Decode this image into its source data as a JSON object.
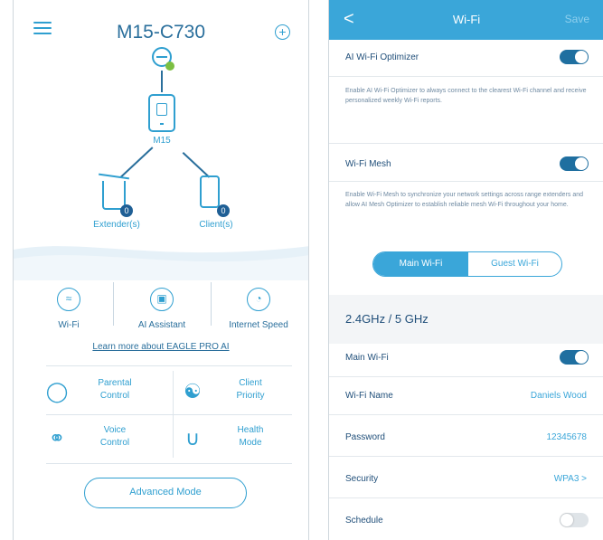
{
  "left": {
    "title": "M15-C730",
    "router_label": "M15",
    "extender_label": "Extender(s)",
    "extender_count": "0",
    "client_label": "Client(s)",
    "client_count": "0",
    "functions": [
      {
        "label": "Wi-Fi",
        "icon": "wifi-icon"
      },
      {
        "label": "AI Assistant",
        "icon": "ai-assistant-icon"
      },
      {
        "label": "Internet Speed",
        "icon": "speedometer-icon"
      }
    ],
    "learn_more": "Learn more about EAGLE PRO AI",
    "tiles": [
      {
        "label": "Parental\nControl",
        "icon": "shield-icon"
      },
      {
        "label": "Client\nPriority",
        "icon": "client-priority-icon"
      },
      {
        "label": "Voice\nControl",
        "icon": "microphone-icon"
      },
      {
        "label": "Health\nMode",
        "icon": "stethoscope-icon"
      }
    ],
    "advanced_mode": "Advanced Mode"
  },
  "right": {
    "header": {
      "back": "<",
      "title": "Wi-Fi",
      "save": "Save"
    },
    "ai_optimizer": {
      "label": "AI Wi-Fi Optimizer",
      "enabled": true,
      "description": "Enable AI Wi-Fi Optimizer to always connect to the clearest Wi-Fi channel and receive personalized weekly Wi-Fi reports."
    },
    "wifi_mesh": {
      "label": "Wi-Fi Mesh",
      "enabled": true,
      "description": "Enable Wi-Fi Mesh to synchronize your network settings across range extenders and allow AI Mesh Optimizer to establish reliable mesh Wi-Fi throughout your home."
    },
    "tabs": {
      "main": "Main Wi-Fi",
      "guest": "Guest Wi-Fi",
      "selected": "main"
    },
    "band_title": "2.4GHz / 5 GHz",
    "rows": [
      {
        "label": "Main Wi-Fi",
        "value": "",
        "toggle": "on"
      },
      {
        "label": "Wi-Fi Name",
        "value": "Daniels Wood",
        "toggle": ""
      },
      {
        "label": "Password",
        "value": "12345678",
        "toggle": ""
      },
      {
        "label": "Security",
        "value": "WPA3 >",
        "toggle": ""
      },
      {
        "label": "Schedule",
        "value": "",
        "toggle": "off"
      }
    ]
  },
  "colors": {
    "accent": "#3aa6d9",
    "dark_blue": "#1f4e79",
    "toggle_on": "#1f6fa0"
  }
}
